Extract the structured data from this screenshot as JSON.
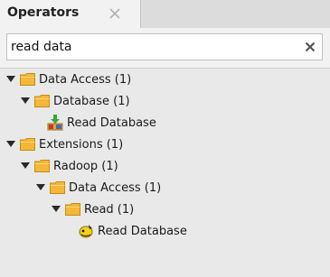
{
  "tab": {
    "title": "Operators"
  },
  "search": {
    "value": "read data",
    "placeholder": ""
  },
  "tree": [
    {
      "label": "Data Access (1)",
      "icon": "folder-icon",
      "expanded": true,
      "level": 0
    },
    {
      "label": "Database (1)",
      "icon": "folder-icon",
      "expanded": true,
      "level": 1
    },
    {
      "label": "Read Database",
      "icon": "database-download-icon",
      "level": 2
    },
    {
      "label": "Extensions (1)",
      "icon": "folder-icon",
      "expanded": true,
      "level": 0
    },
    {
      "label": "Radoop (1)",
      "icon": "folder-icon",
      "expanded": true,
      "level": 1
    },
    {
      "label": "Data Access (1)",
      "icon": "folder-icon",
      "expanded": true,
      "level": 2
    },
    {
      "label": "Read (1)",
      "icon": "folder-icon",
      "expanded": true,
      "level": 3
    },
    {
      "label": "Read Database",
      "icon": "radoop-operator-icon",
      "level": 4
    }
  ]
}
